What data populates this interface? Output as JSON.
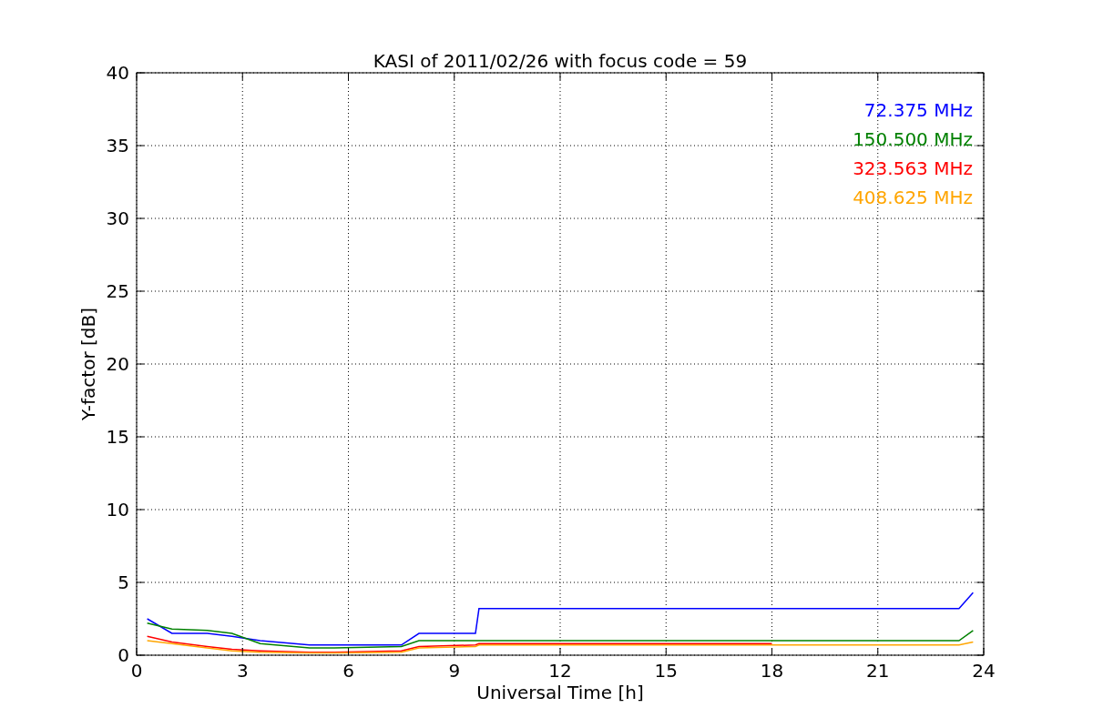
{
  "figure": {
    "chart_data": {
      "type": "line",
      "title": "KASI of 2011/02/26 with focus code = 59",
      "xlabel": "Universal Time [h]",
      "ylabel": "Y-factor [dB]",
      "x": [
        0.3,
        1,
        2,
        2.7,
        3.5,
        4.9,
        5.6,
        7.5,
        8,
        9.6,
        9.7,
        12,
        18,
        23.3,
        23.7
      ],
      "series": [
        {
          "name": "72.375 MHz",
          "color": "#0000ff",
          "values": [
            2.5,
            1.5,
            1.5,
            1.3,
            1.0,
            0.7,
            0.7,
            0.7,
            1.5,
            1.5,
            3.2,
            3.2,
            3.2,
            3.2,
            4.3
          ]
        },
        {
          "name": "150.500 MHz",
          "color": "#008000",
          "values": [
            2.2,
            1.8,
            1.7,
            1.5,
            0.8,
            0.5,
            0.5,
            0.6,
            1.0,
            1.0,
            1.0,
            1.0,
            1.0,
            1.0,
            1.7
          ]
        },
        {
          "name": "323.563 MHz",
          "color": "#ff0000",
          "values": [
            1.3,
            0.9,
            0.6,
            0.4,
            0.3,
            0.2,
            0.2,
            0.3,
            0.6,
            0.7,
            0.8,
            0.8,
            0.8,
            null,
            null
          ]
        },
        {
          "name": "408.625 MHz",
          "color": "#ffa500",
          "values": [
            1.0,
            0.8,
            0.5,
            0.3,
            0.2,
            0.15,
            0.15,
            0.2,
            0.5,
            0.6,
            0.7,
            0.7,
            0.7,
            0.7,
            0.9
          ]
        }
      ],
      "xlim": [
        0,
        24
      ],
      "grid": true,
      "ylim": [
        0,
        40
      ],
      "xticks": [
        0,
        3,
        6,
        9,
        12,
        15,
        18,
        21,
        24
      ],
      "yticks": [
        0,
        5,
        10,
        15,
        20,
        25,
        30,
        35,
        40
      ]
    }
  }
}
